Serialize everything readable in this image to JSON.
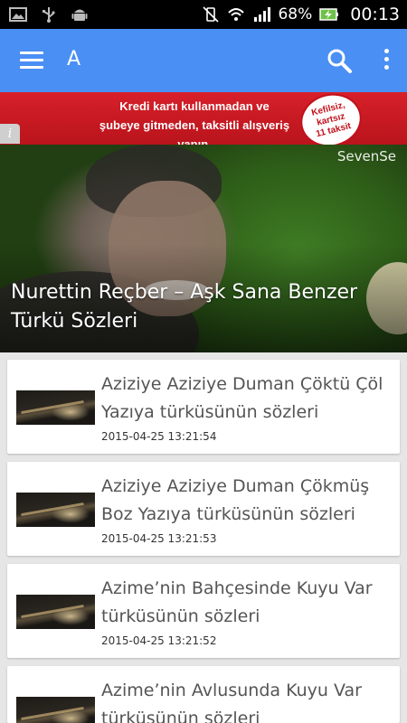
{
  "status_bar": {
    "battery_percent": "68%",
    "time": "00:13"
  },
  "app_bar": {
    "title": "A"
  },
  "ad": {
    "line1": "Kredi kartı kullanmadan ve",
    "line2": "şubeye gitmeden, taksitli alışveriş yapın.",
    "badge_line1": "Kefilsiz,",
    "badge_line2": "kartsız",
    "badge_line3": "11 taksit",
    "info_label": "i"
  },
  "hero": {
    "brand": "SevenSe",
    "title": "Nurettin Reçber – Aşk Sana Benzer Türkü Sözleri"
  },
  "articles": [
    {
      "title": "Aziziye Aziziye Duman Çöktü Çöl Yazıya türküsünün sözleri",
      "date": "2015-04-25 13:21:54"
    },
    {
      "title": "Aziziye Aziziye Duman Çökmüş Boz Yazıya türküsünün sözleri",
      "date": "2015-04-25 13:21:53"
    },
    {
      "title": "Azime’nin Bahçesinde Kuyu Var türküsünün sözleri",
      "date": "2015-04-25 13:21:52"
    },
    {
      "title": "Azime’nin Avlusunda Kuyu Var türküsünün sözleri",
      "date": ""
    }
  ],
  "icons": {
    "status_left": [
      "image-icon",
      "usb-icon",
      "android-icon"
    ],
    "status_right": [
      "vibrate-icon",
      "wifi-icon",
      "signal-icon",
      "battery-charging-icon"
    ],
    "app_bar": [
      "menu-icon",
      "search-icon",
      "overflow-menu-icon"
    ]
  },
  "colors": {
    "app_bar": "#4a8ff4",
    "ad_background": "#d7202a",
    "page_background": "#e6e6e6"
  }
}
